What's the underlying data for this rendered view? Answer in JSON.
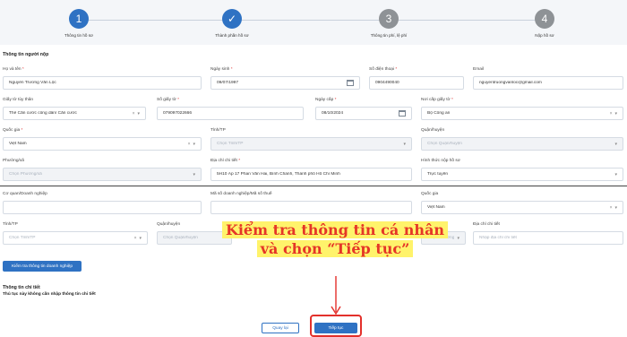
{
  "stepper": {
    "steps": [
      {
        "number": "1",
        "label": "Thông tin hồ sơ",
        "state": "active"
      },
      {
        "number": "✓",
        "label": "Thành phần hồ sơ",
        "state": "done"
      },
      {
        "number": "3",
        "label": "Thông tin phí, lệ phí",
        "state": "pending"
      },
      {
        "number": "4",
        "label": "Nộp hồ sơ",
        "state": "pending"
      }
    ]
  },
  "applicant": {
    "section_title": "Thông tin người nộp",
    "full_name": {
      "label": "Họ và tên",
      "value": "Nguyễn Trương Văn Lộc"
    },
    "dob": {
      "label": "Ngày sinh",
      "value": "09/07/1997"
    },
    "phone": {
      "label": "Số điện thoại",
      "value": "0904490040"
    },
    "email": {
      "label": "Email",
      "value": "nguyentruongvanloc@gmail.com"
    },
    "id_type": {
      "label": "Giấy tờ tùy thân",
      "value": "Thẻ Căn cước công dân/ Căn cước"
    },
    "id_number": {
      "label": "Số giấy tờ",
      "value": "079097022666"
    },
    "issue_date": {
      "label": "Ngày cấp",
      "value": "08/10/2024"
    },
    "issue_place": {
      "label": "Nơi cấp giấy tờ",
      "value": "Bộ Công an"
    },
    "country": {
      "label": "Quốc gia",
      "value": "Việt Nam"
    },
    "province": {
      "label": "Tỉnh/TP",
      "placeholder": "Chọn Tỉnh/TP"
    },
    "district": {
      "label": "Quận/huyện",
      "placeholder": "Chọn Quận/huyện"
    },
    "ward": {
      "label": "Phường/xã",
      "placeholder": "Chọn Phường/xã"
    },
    "address": {
      "label": "Địa chỉ chi tiết",
      "value": "5H10 Ấp 17 Phan Văn Hai, Bình Chánh, Thành phố Hồ Chí Minh"
    },
    "submit_method": {
      "label": "Hình thức nộp hồ sơ",
      "value": "Trực tuyến"
    }
  },
  "business": {
    "company": {
      "label": "Cơ quan/Doanh nghiệp",
      "value": ""
    },
    "tax_code": {
      "label": "Mã số doanh nghiệp/Mã số thuế",
      "value": ""
    },
    "country": {
      "label": "Quốc gia",
      "value": "Việt Nam"
    },
    "province": {
      "label": "Tỉnh/TP",
      "placeholder": "Chọn Tỉnh/TP"
    },
    "district": {
      "label": "Quận/huyện",
      "placeholder": "Chọn Quận/huyện"
    },
    "ward_placeholder": "Chọn Phường/xã",
    "address": {
      "label": "Địa chỉ chi tiết",
      "placeholder": "Nhập địa chỉ chi tiết"
    },
    "check_button": "Kiểm tra thông tin doanh nghiệp"
  },
  "details": {
    "title": "Thông tin chi tiết",
    "note": "Thủ tục này không cần nhập thông tin chi tiết"
  },
  "footer": {
    "back_button": "Quay lại",
    "next_button": "Tiếp tục"
  },
  "annotation": {
    "line1": "Kiểm tra thông tin cá nhân",
    "line2": "và chọn “Tiếp tục”"
  },
  "colors": {
    "primary": "#2f72c3",
    "annotation_red": "#e53527",
    "highlight": "#fff36b"
  }
}
